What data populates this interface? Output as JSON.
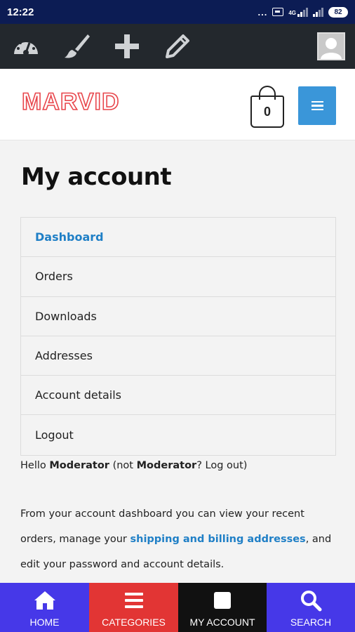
{
  "status_bar": {
    "time": "12:22",
    "dots": "...",
    "network": "4G",
    "battery": "82"
  },
  "admin_bar": {
    "icons": [
      "dashboard-gauge-icon",
      "paintbrush-icon",
      "plus-icon",
      "pencil-icon"
    ],
    "avatar": "user-avatar-icon",
    "background": "#23282d"
  },
  "header": {
    "logo": "MARVID",
    "cart_count": "0",
    "logo_color": "#e8464c",
    "menu_button_color": "#3a96d9"
  },
  "page": {
    "title": "My account",
    "nav": [
      {
        "label": "Dashboard",
        "active": true
      },
      {
        "label": "Orders"
      },
      {
        "label": "Downloads"
      },
      {
        "label": "Addresses"
      },
      {
        "label": "Account details"
      },
      {
        "label": "Logout"
      }
    ],
    "hello": {
      "prefix": "Hello ",
      "user": "Moderator",
      "mid": " (not ",
      "user2": "Moderator",
      "q": "? ",
      "logout": "Log out",
      "suffix": ")"
    },
    "description": {
      "part1": "From your account dashboard you can view your recent orders, manage your ",
      "link": "shipping and billing addresses",
      "part2": ", and edit your password and account details."
    },
    "link_color": "#1f7fc6"
  },
  "bottom_nav": [
    {
      "label": "HOME",
      "icon": "home-icon",
      "color": "#4638e8"
    },
    {
      "label": "CATEGORIES",
      "icon": "menu-lines-icon",
      "color": "#e23534"
    },
    {
      "label": "MY ACCOUNT",
      "icon": "account-square-icon",
      "color": "#111111"
    },
    {
      "label": "SEARCH",
      "icon": "search-icon",
      "color": "#4638e8"
    }
  ]
}
